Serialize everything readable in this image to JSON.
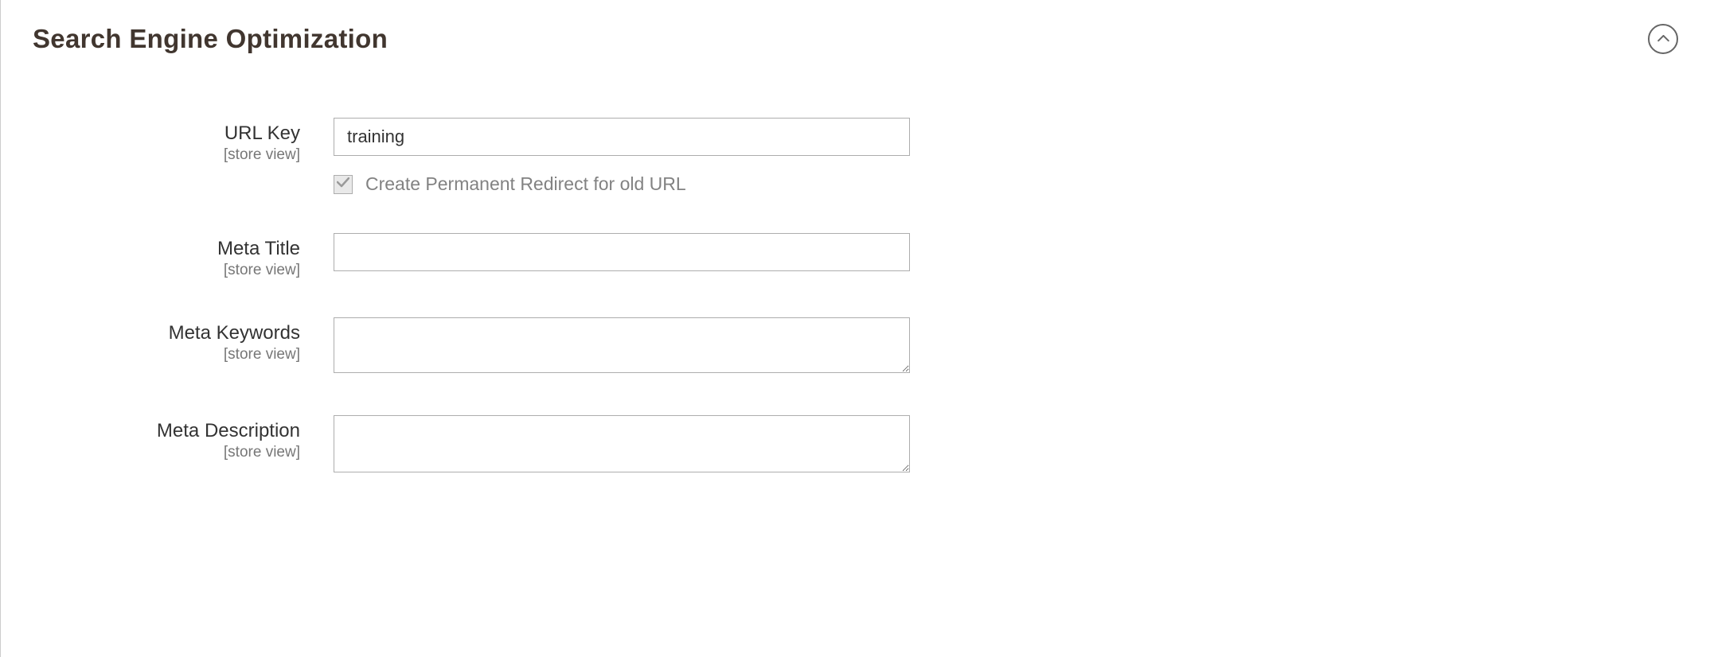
{
  "section": {
    "title": "Search Engine Optimization"
  },
  "fields": {
    "url_key": {
      "label": "URL Key",
      "scope": "[store view]",
      "value": "training",
      "redirect_checked": true,
      "redirect_label": "Create Permanent Redirect for old URL"
    },
    "meta_title": {
      "label": "Meta Title",
      "scope": "[store view]",
      "value": ""
    },
    "meta_keywords": {
      "label": "Meta Keywords",
      "scope": "[store view]",
      "value": ""
    },
    "meta_description": {
      "label": "Meta Description",
      "scope": "[store view]",
      "value": ""
    }
  }
}
